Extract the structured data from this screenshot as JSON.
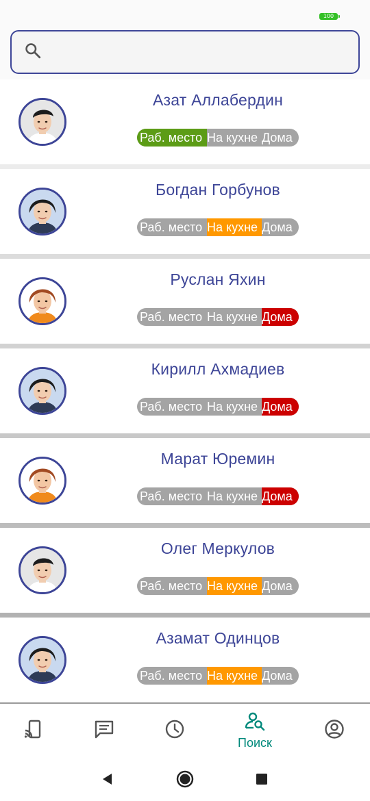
{
  "status_bar": {
    "battery": "100"
  },
  "search": {
    "placeholder": "",
    "value": ""
  },
  "status_labels": {
    "workplace": "Раб. место",
    "kitchen": "На кухне",
    "home": "Дома"
  },
  "colors": {
    "accent": "#3d4597",
    "workplace_active": "#5c9c16",
    "kitchen_active": "#ff9800",
    "home_active": "#cc0000",
    "inactive": "#a4a4a4",
    "nav_active": "#00897b",
    "nav_inactive": "#555555"
  },
  "people": [
    {
      "name": "Азат Аллабердин",
      "status": "workplace",
      "avatar": "face-light"
    },
    {
      "name": "Богдан Горбунов",
      "status": "kitchen",
      "avatar": "face-dark-hair"
    },
    {
      "name": "Руслан Яхин",
      "status": "home",
      "avatar": "face-orange"
    },
    {
      "name": "Кирилл Ахмадиев",
      "status": "home",
      "avatar": "face-dark-hair"
    },
    {
      "name": "Марат Юремин",
      "status": "home",
      "avatar": "face-orange"
    },
    {
      "name": "Олег Меркулов",
      "status": "kitchen",
      "avatar": "face-light"
    },
    {
      "name": "Азамат Одинцов",
      "status": "kitchen",
      "avatar": "face-dark-hair"
    }
  ],
  "bottom_nav": [
    {
      "icon": "cast-icon",
      "label": ""
    },
    {
      "icon": "chat-icon",
      "label": ""
    },
    {
      "icon": "clock-icon",
      "label": ""
    },
    {
      "icon": "person-search-icon",
      "label": "Поиск",
      "active": true
    },
    {
      "icon": "account-circle-icon",
      "label": ""
    }
  ],
  "system_nav": [
    "back-icon",
    "home-icon",
    "recents-icon"
  ]
}
